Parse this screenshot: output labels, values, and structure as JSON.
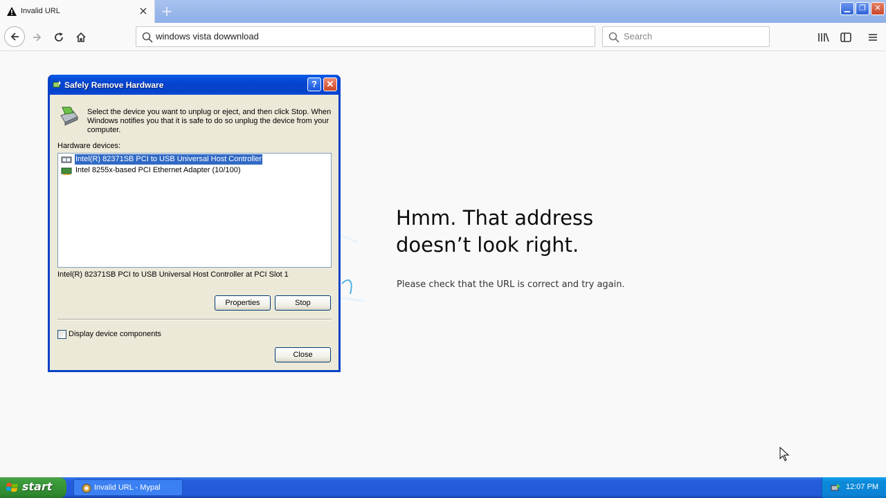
{
  "browser": {
    "tab_title": "Invalid URL",
    "url_value": "windows vista dowwnload",
    "search_placeholder": "Search"
  },
  "error_page": {
    "title": "Hmm. That address doesn’t look right.",
    "message": "Please check that the URL is correct and try again."
  },
  "dialog": {
    "title": "Safely Remove Hardware",
    "help_label": "?",
    "instructions": "Select the device you want to unplug or eject, and then click Stop. When Windows notifies you that it is safe to do so unplug the device from your computer.",
    "hardware_label": "Hardware devices:",
    "devices": [
      {
        "label": "Intel(R) 82371SB PCI to USB Universal Host Controller",
        "selected": true,
        "icon": "usb-icon"
      },
      {
        "label": "Intel 8255x-based PCI Ethernet Adapter (10/100)",
        "selected": false,
        "icon": "network-card-icon"
      }
    ],
    "selected_description": "Intel(R) 82371SB PCI to USB Universal Host Controller at PCI Slot 1",
    "properties_label": "Properties",
    "stop_label": "Stop",
    "display_components_label": "Display device components",
    "display_components_checked": false,
    "close_label": "Close"
  },
  "taskbar": {
    "start_label": "start",
    "task_label": "Invalid URL - Mypal",
    "clock": "12:07 PM"
  },
  "colors": {
    "xp_blue": "#0842c7",
    "dialog_face": "#ece9d8",
    "selection": "#316ac5",
    "start_green": "#3b9b3b"
  }
}
